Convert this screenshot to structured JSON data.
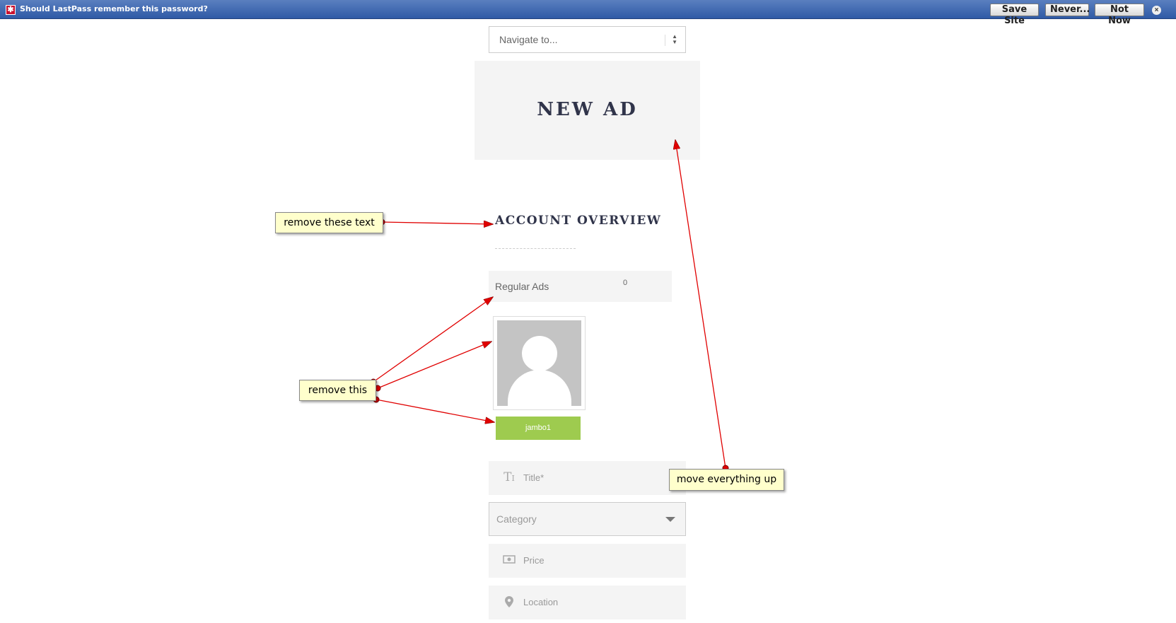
{
  "lastpass_bar": {
    "message": "Should LastPass remember this password?",
    "buttons": {
      "save_site": "Save Site",
      "never": "Never...",
      "not_now": "Not Now"
    },
    "logo_glyph": "✱",
    "close_glyph": "×",
    "background_color": "#3a64ad"
  },
  "navigation": {
    "select_value": "Navigate to...",
    "arrows_glyph": "▲▼"
  },
  "hero": {
    "title": "NEW AD"
  },
  "account": {
    "title": "ACCOUNT OVERVIEW",
    "regular_ads_label": "Regular Ads",
    "regular_ads_count": "0"
  },
  "user": {
    "username": "jambo1",
    "button_color": "#9ecb4f"
  },
  "form": {
    "title_placeholder": "Title*",
    "title_icon": "text-size-icon",
    "category_placeholder": "Category",
    "price_placeholder": "Price",
    "price_icon": "money-icon",
    "location_placeholder": "Location",
    "location_icon": "map-pin-icon"
  },
  "annotations": [
    {
      "text": "remove these text"
    },
    {
      "text": "remove this"
    },
    {
      "text": "move everything up"
    }
  ],
  "annotation_color": "#ffffcc",
  "arrow_color": "#e00000"
}
